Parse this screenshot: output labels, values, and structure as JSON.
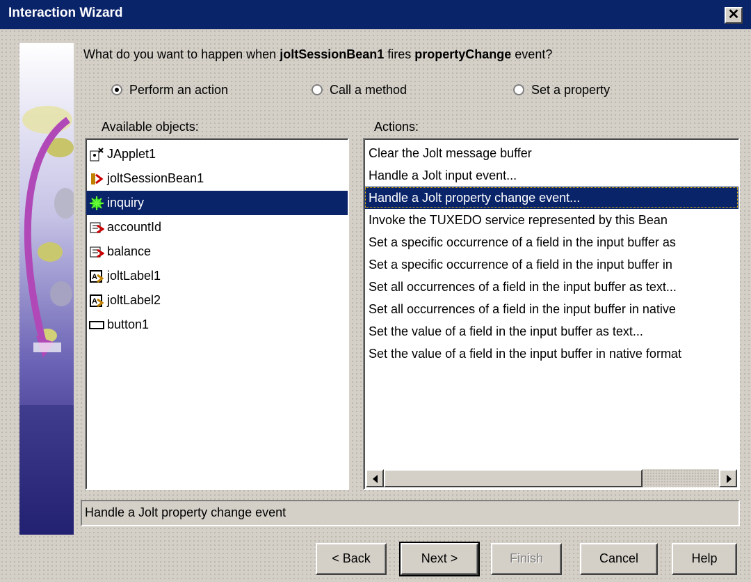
{
  "window": {
    "title": "Interaction Wizard",
    "close_glyph": "✕"
  },
  "question": {
    "prefix": "What do you want to happen when ",
    "source": "joltSessionBean1",
    "middle": " fires ",
    "event": "propertyChange",
    "suffix": " event?"
  },
  "options": [
    {
      "label": "Perform an action",
      "selected": true
    },
    {
      "label": "Call a method",
      "selected": false
    },
    {
      "label": "Set a property",
      "selected": false
    }
  ],
  "objects_label": "Available objects:",
  "actions_label": "Actions:",
  "objects": [
    {
      "name": "JApplet1",
      "icon": "applet-icon"
    },
    {
      "name": "joltSessionBean1",
      "icon": "session-bean-icon"
    },
    {
      "name": "inquiry",
      "icon": "service-bean-icon",
      "selected": true
    },
    {
      "name": "accountId",
      "icon": "text-field-icon"
    },
    {
      "name": "balance",
      "icon": "text-field-icon"
    },
    {
      "name": "joltLabel1",
      "icon": "label-icon"
    },
    {
      "name": "joltLabel2",
      "icon": "label-icon"
    },
    {
      "name": "button1",
      "icon": "button-icon"
    }
  ],
  "actions": [
    "Clear the Jolt message buffer",
    "Handle a Jolt input event...",
    "Handle a Jolt property change event...",
    "Invoke the TUXEDO service represented by this Bean",
    "Set a specific occurrence of a field in the input buffer as",
    "Set a specific occurrence of a field in the input buffer in",
    "Set all occurrences of a field in the input buffer as text...",
    "Set all occurrences of a field in the input buffer in native",
    "Set the value of a field in the input buffer as text...",
    "Set the value of a field in the input buffer in native format"
  ],
  "selected_action_index": 2,
  "status_text": "Handle a Jolt property change event",
  "buttons": {
    "back": "< Back",
    "next": "Next >",
    "finish": "Finish",
    "cancel": "Cancel",
    "help": "Help"
  },
  "colors": {
    "title_bar": "#0a246a",
    "selection": "#0a246a",
    "face": "#d4d0c8"
  }
}
